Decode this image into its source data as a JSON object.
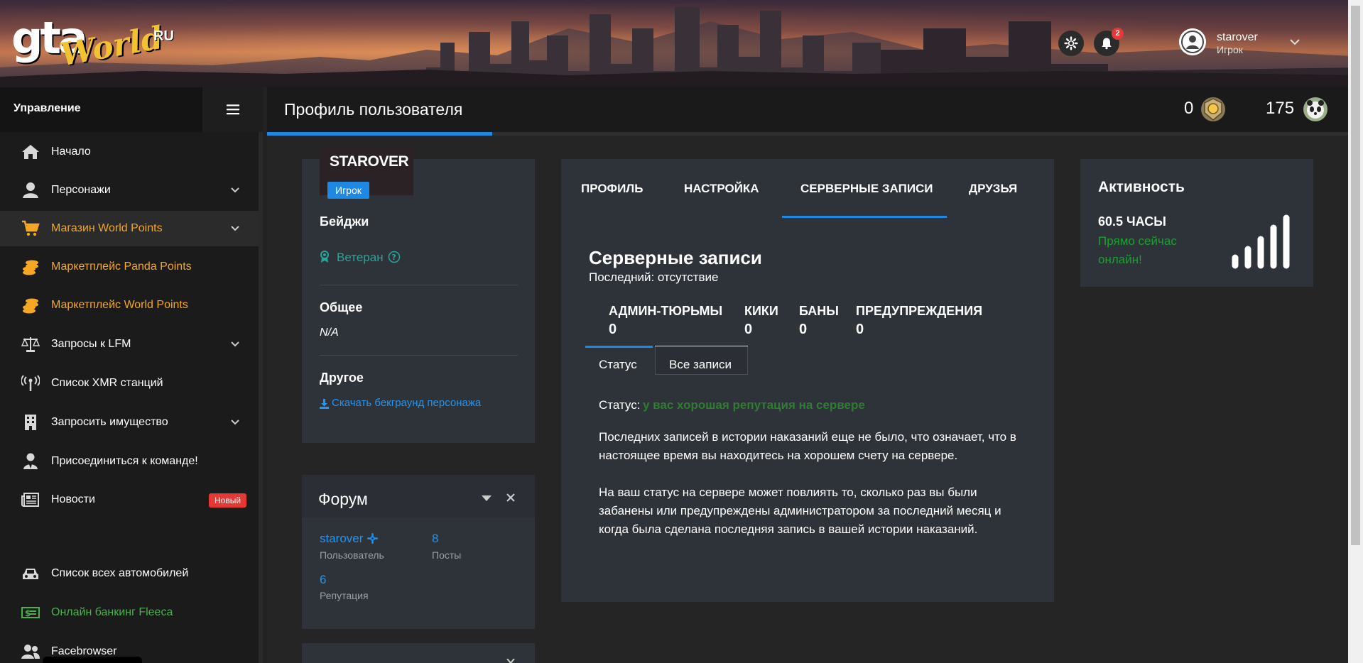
{
  "header": {
    "logo": {
      "gta": "gta",
      "world": "World",
      "ru": "RU"
    },
    "notifications_count": "2",
    "user": {
      "name": "starover",
      "role": "Игрок"
    }
  },
  "sidebar": {
    "title": "Управление",
    "items": [
      {
        "label": "Начало",
        "icon": "home-icon"
      },
      {
        "label": "Персонажи",
        "icon": "user-icon"
      },
      {
        "label": "Магазин World Points",
        "icon": "cart-icon"
      },
      {
        "label": "Маркетплейс Panda Points",
        "icon": "coins-icon"
      },
      {
        "label": "Маркетплейс World Points",
        "icon": "coins-icon"
      },
      {
        "label": "Запросы к LFM",
        "icon": "scales-icon"
      },
      {
        "label": "Список XMR станций",
        "icon": "antenna-icon"
      },
      {
        "label": "Запросить имущество",
        "icon": "building-icon"
      },
      {
        "label": "Присоединиться к команде!",
        "icon": "user-tie-icon"
      },
      {
        "label": "Новости",
        "icon": "newspaper-icon",
        "badge": "Новый"
      },
      {
        "label": "Список всех автомобилей",
        "icon": "car-icon"
      },
      {
        "label": "Онлайн банкинг Fleeca",
        "icon": "money-icon"
      },
      {
        "label": "Facebrowser",
        "icon": "users-icon"
      }
    ]
  },
  "topbar": {
    "title": "Профиль пользователя",
    "points_count": "0",
    "panda_count": "175"
  },
  "profile": {
    "name": "STAROVER",
    "role": "Игрок",
    "badges_title": "Бейджи",
    "badge": "Ветеран",
    "general_title": "Общее",
    "general_value": "N/A",
    "other_title": "Другое",
    "download_link": "Скачать бекграунд персонажа"
  },
  "forum": {
    "title": "Форум",
    "username": "starover",
    "username_label": "Пользователь",
    "posts": "8",
    "posts_label": "Посты",
    "reputation": "6",
    "reputation_label": "Репутация"
  },
  "main": {
    "tabs": [
      "ПРОФИЛЬ",
      "НАСТРОЙКА",
      "СЕРВЕРНЫЕ ЗАПИСИ",
      "ДРУЗЬЯ"
    ],
    "active_tab": "СЕРВЕРНЫЕ ЗАПИСИ",
    "section_title": "Серверные записи",
    "last_record": "Последний: отсутствие",
    "stats": [
      {
        "label": "АДМИН-ТЮРЬМЫ",
        "value": "0"
      },
      {
        "label": "КИКИ",
        "value": "0"
      },
      {
        "label": "БАНЫ",
        "value": "0"
      },
      {
        "label": "ПРЕДУПРЕЖДЕНИЯ",
        "value": "0"
      }
    ],
    "subtabs": [
      "Статус",
      "Все записи"
    ],
    "status_label": "Статус:",
    "status_value": "у вас хорошая репутация на сервере",
    "paragraph1": "Последних записей в истории наказаний еще не было, что означает, что в настоящее время вы находитесь на хорошем счету на сервере.",
    "paragraph2": "На ваш статус на сервере может повлиять то, сколько раз вы были забанены или предупреждены администратором за последний месяц и когда была сделана последняя запись в вашей истории наказаний."
  },
  "activity": {
    "title": "Активность",
    "hours": "60.5 ЧАСЫ",
    "status": "Прямо сейчас онлайн!"
  },
  "colors": {
    "accent": "#1e88e5",
    "orange": "#f5a623",
    "green": "#4caf50",
    "status_green": "#2e7d32",
    "badge_red": "#e53935",
    "teal": "#26a69a"
  }
}
